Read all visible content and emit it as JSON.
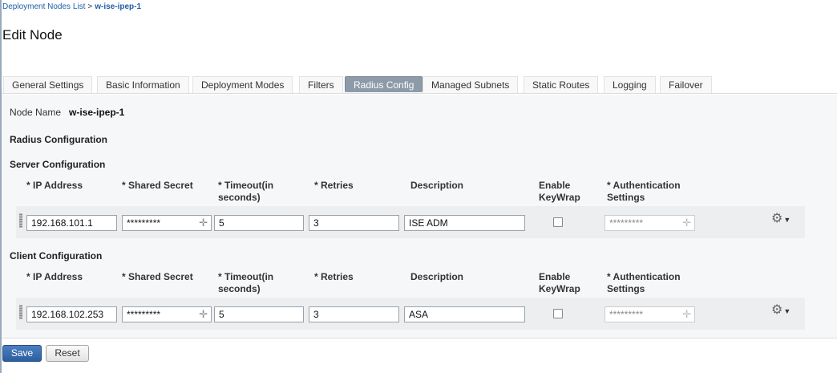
{
  "breadcrumb": {
    "parent": "Deployment Nodes List",
    "separator": ">",
    "current": "w-ise-ipep-1"
  },
  "page_title": "Edit Node",
  "tabs": [
    {
      "label": "General Settings",
      "active": false
    },
    {
      "label": "Basic Information",
      "active": false
    },
    {
      "label": "Deployment Modes",
      "active": false
    },
    {
      "label": "Filters",
      "active": false
    },
    {
      "label": "Radius Config",
      "active": true
    },
    {
      "label": "Managed Subnets",
      "active": false
    },
    {
      "label": "Static Routes",
      "active": false
    },
    {
      "label": "Logging",
      "active": false
    },
    {
      "label": "Failover",
      "active": false
    }
  ],
  "node": {
    "label": "Node Name",
    "value": "w-ise-ipep-1"
  },
  "radius_heading": "Radius Configuration",
  "columns": {
    "ip": "* IP Address",
    "secret": "* Shared Secret",
    "timeout_1": "* Timeout(in",
    "timeout_2": "seconds)",
    "retries": "* Retries",
    "description": "Description",
    "keywrap_1": "Enable",
    "keywrap_2": "KeyWrap",
    "auth_1": "* Authentication",
    "auth_2": "Settings"
  },
  "server": {
    "heading": "Server Configuration",
    "ip": "192.168.101.1",
    "secret": "*********",
    "timeout": "5",
    "retries": "3",
    "description": "ISE ADM",
    "keywrap_checked": false,
    "auth": "*********"
  },
  "client": {
    "heading": "Client Configuration",
    "ip": "192.168.102.253",
    "secret": "*********",
    "timeout": "5",
    "retries": "3",
    "description": "ASA",
    "keywrap_checked": false,
    "auth": "*********"
  },
  "icons": {
    "add": "plus-icon",
    "actions": "gear-icon"
  },
  "buttons": {
    "save": "Save",
    "reset": "Reset"
  },
  "colors": {
    "primary_button": "#2c5e9e",
    "active_tab": "#8d9aa8",
    "link": "#1f5fa8"
  }
}
